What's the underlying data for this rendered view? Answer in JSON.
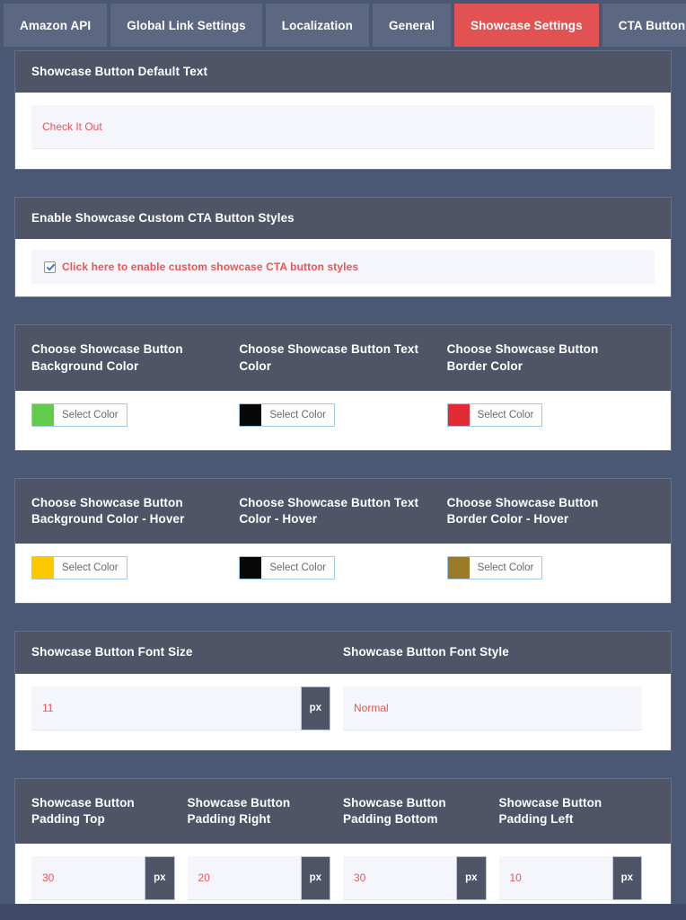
{
  "tabs": [
    {
      "label": "Amazon API",
      "active": false
    },
    {
      "label": "Global Link Settings",
      "active": false
    },
    {
      "label": "Localization",
      "active": false
    },
    {
      "label": "General",
      "active": false
    },
    {
      "label": "Showcase Settings",
      "active": true
    },
    {
      "label": "CTA Button Settings",
      "active": false
    }
  ],
  "colors": {
    "page_background": "#4b5874",
    "panel_header": "#4f5467",
    "active_tab": "#e25252",
    "inactive_tab": "#5c6881",
    "input_background": "#f4f6fc",
    "input_text": "#ee5253",
    "addon_background": "#4f5467"
  },
  "sections": {
    "default_text": {
      "title": "Showcase Button Default Text",
      "input_value": "Check It Out",
      "input_placeholder": "Check It Out"
    },
    "enable_styles": {
      "title": "Enable Showcase Custom CTA Button Styles",
      "checkbox_label": "Click here to enable custom showcase CTA button styles",
      "checked": true
    },
    "colors_normal": {
      "fields": [
        {
          "label": "Choose Showcase Button Background Color",
          "button_label": "Select Color",
          "swatch": "#62cc4a"
        },
        {
          "label": "Choose Showcase Button Text Color",
          "button_label": "Select Color",
          "swatch": "#080808"
        },
        {
          "label": "Choose Showcase Button Border Color",
          "button_label": "Select Color",
          "swatch": "#e32b33"
        }
      ]
    },
    "colors_hover": {
      "fields": [
        {
          "label": "Choose Showcase Button Background Color - Hover",
          "button_label": "Select Color",
          "swatch": "#fdc800"
        },
        {
          "label": "Choose Showcase Button Text Color - Hover",
          "button_label": "Select Color",
          "swatch": "#080808"
        },
        {
          "label": "Choose Showcase Button Border Color - Hover",
          "button_label": "Select Color",
          "swatch": "#9a7b28"
        }
      ]
    },
    "font": {
      "size_label": "Showcase Button Font Size",
      "size_value": "11",
      "size_unit": "px",
      "style_label": "Showcase Button Font Style",
      "style_value": "Normal"
    },
    "padding": {
      "fields": [
        {
          "label": "Showcase Button Padding Top",
          "value": "30",
          "unit": "px"
        },
        {
          "label": "Showcase Button Padding Right",
          "value": "20",
          "unit": "px"
        },
        {
          "label": "Showcase Button Padding Bottom",
          "value": "30",
          "unit": "px"
        },
        {
          "label": "Showcase Button Padding Left",
          "value": "10",
          "unit": "px"
        }
      ]
    }
  }
}
